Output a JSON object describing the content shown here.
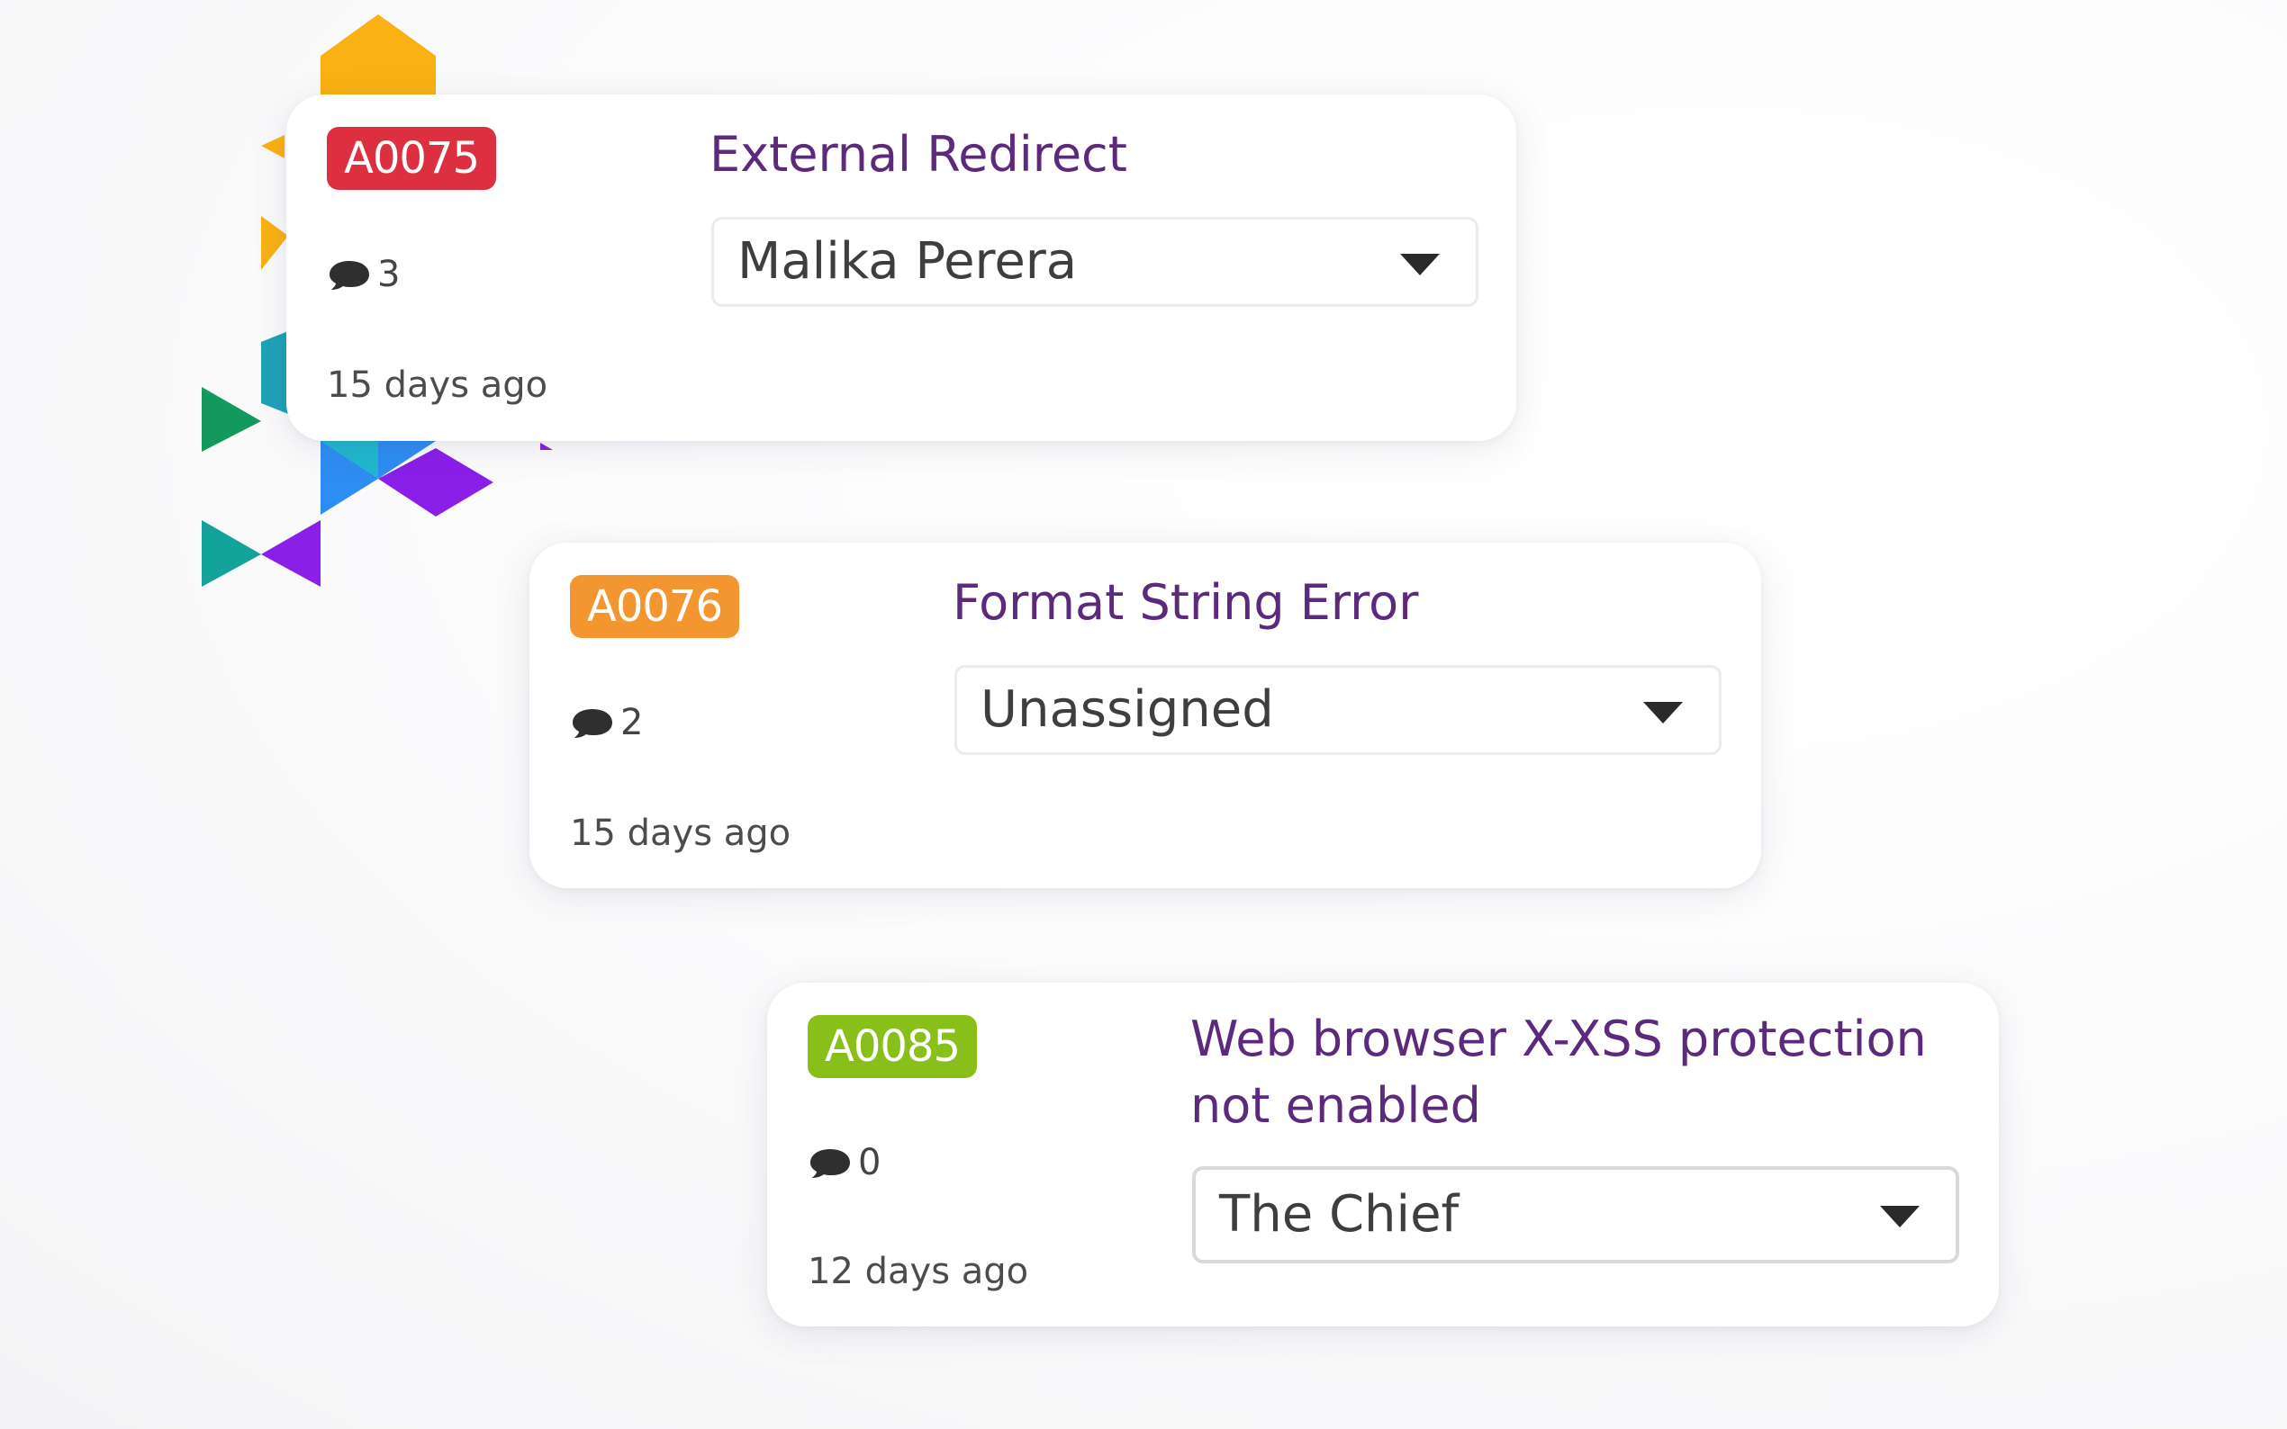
{
  "colors": {
    "title": "#5c2a7c",
    "badge_critical": "#dc3040",
    "badge_high": "#f39630",
    "badge_low": "#88bf1a"
  },
  "icons": {
    "comment": "speech-bubble-icon",
    "dropdown": "caret-down-icon"
  },
  "issues": [
    {
      "id": "A0075",
      "title": "External Redirect",
      "comments": "3",
      "age": "15 days ago",
      "assignee": "Malika Perera"
    },
    {
      "id": "A0076",
      "title": "Format String Error",
      "comments": "2",
      "age": "15 days ago",
      "assignee": "Unassigned"
    },
    {
      "id": "A0085",
      "title": "Web browser X-XSS protection not enabled",
      "comments": "0",
      "age": "12 days ago",
      "assignee": "The Chief"
    }
  ]
}
